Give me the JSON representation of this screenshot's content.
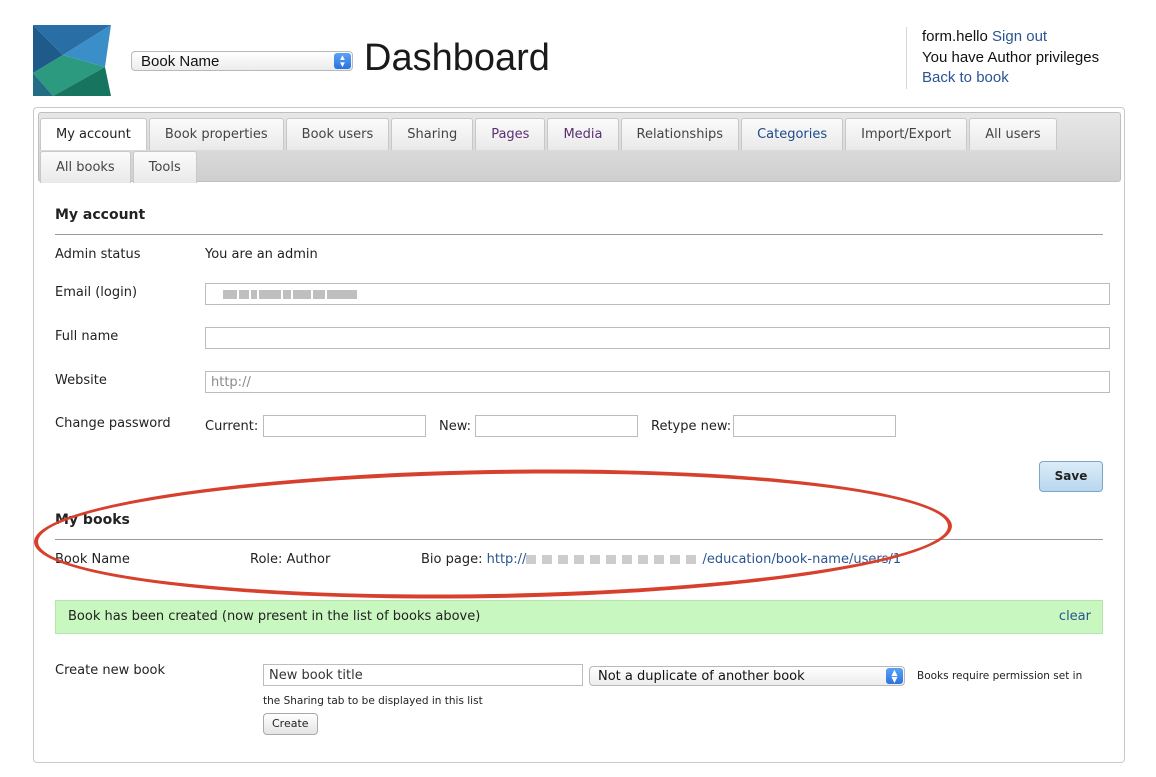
{
  "header": {
    "book_select_value": "Book Name",
    "title": "Dashboard",
    "user_name": "form.hello",
    "sign_out": "Sign out",
    "privileges": "You have Author privileges",
    "back_to_book": "Back to book"
  },
  "tabs": {
    "row1": [
      "My account",
      "Book properties",
      "Book users",
      "Sharing",
      "Pages",
      "Media",
      "Relationships",
      "Categories",
      "Import/Export",
      "All users"
    ],
    "row2": [
      "All books",
      "Tools"
    ],
    "active": "My account"
  },
  "account": {
    "section_title": "My account",
    "admin_status_label": "Admin status",
    "admin_status_value": "You are an admin",
    "email_label": "Email (login)",
    "fullname_label": "Full name",
    "website_label": "Website",
    "website_placeholder": "http://",
    "password_label": "Change password",
    "current_label": "Current:",
    "new_label": "New:",
    "retype_label": "Retype new:",
    "save_label": "Save"
  },
  "books": {
    "section_title": "My books",
    "book_name": "Book Name",
    "role": "Role: Author",
    "bio_label": "Bio page:",
    "bio_prefix": "http://",
    "bio_suffix": "/education/book-name/users/1"
  },
  "notice": {
    "message": "Book has been created (now present in the list of books above)",
    "clear": "clear"
  },
  "create": {
    "label": "Create new book",
    "title_value": "New book title",
    "duplicate_select": "Not a duplicate of another book",
    "help_part1": "Books require permission set in",
    "help_part2": "the Sharing tab to be displayed in this list",
    "button": "Create"
  },
  "colors": {
    "accent_link": "#2a5591",
    "success_bg": "#c8f7c0",
    "annotation_red": "#d8402e"
  }
}
